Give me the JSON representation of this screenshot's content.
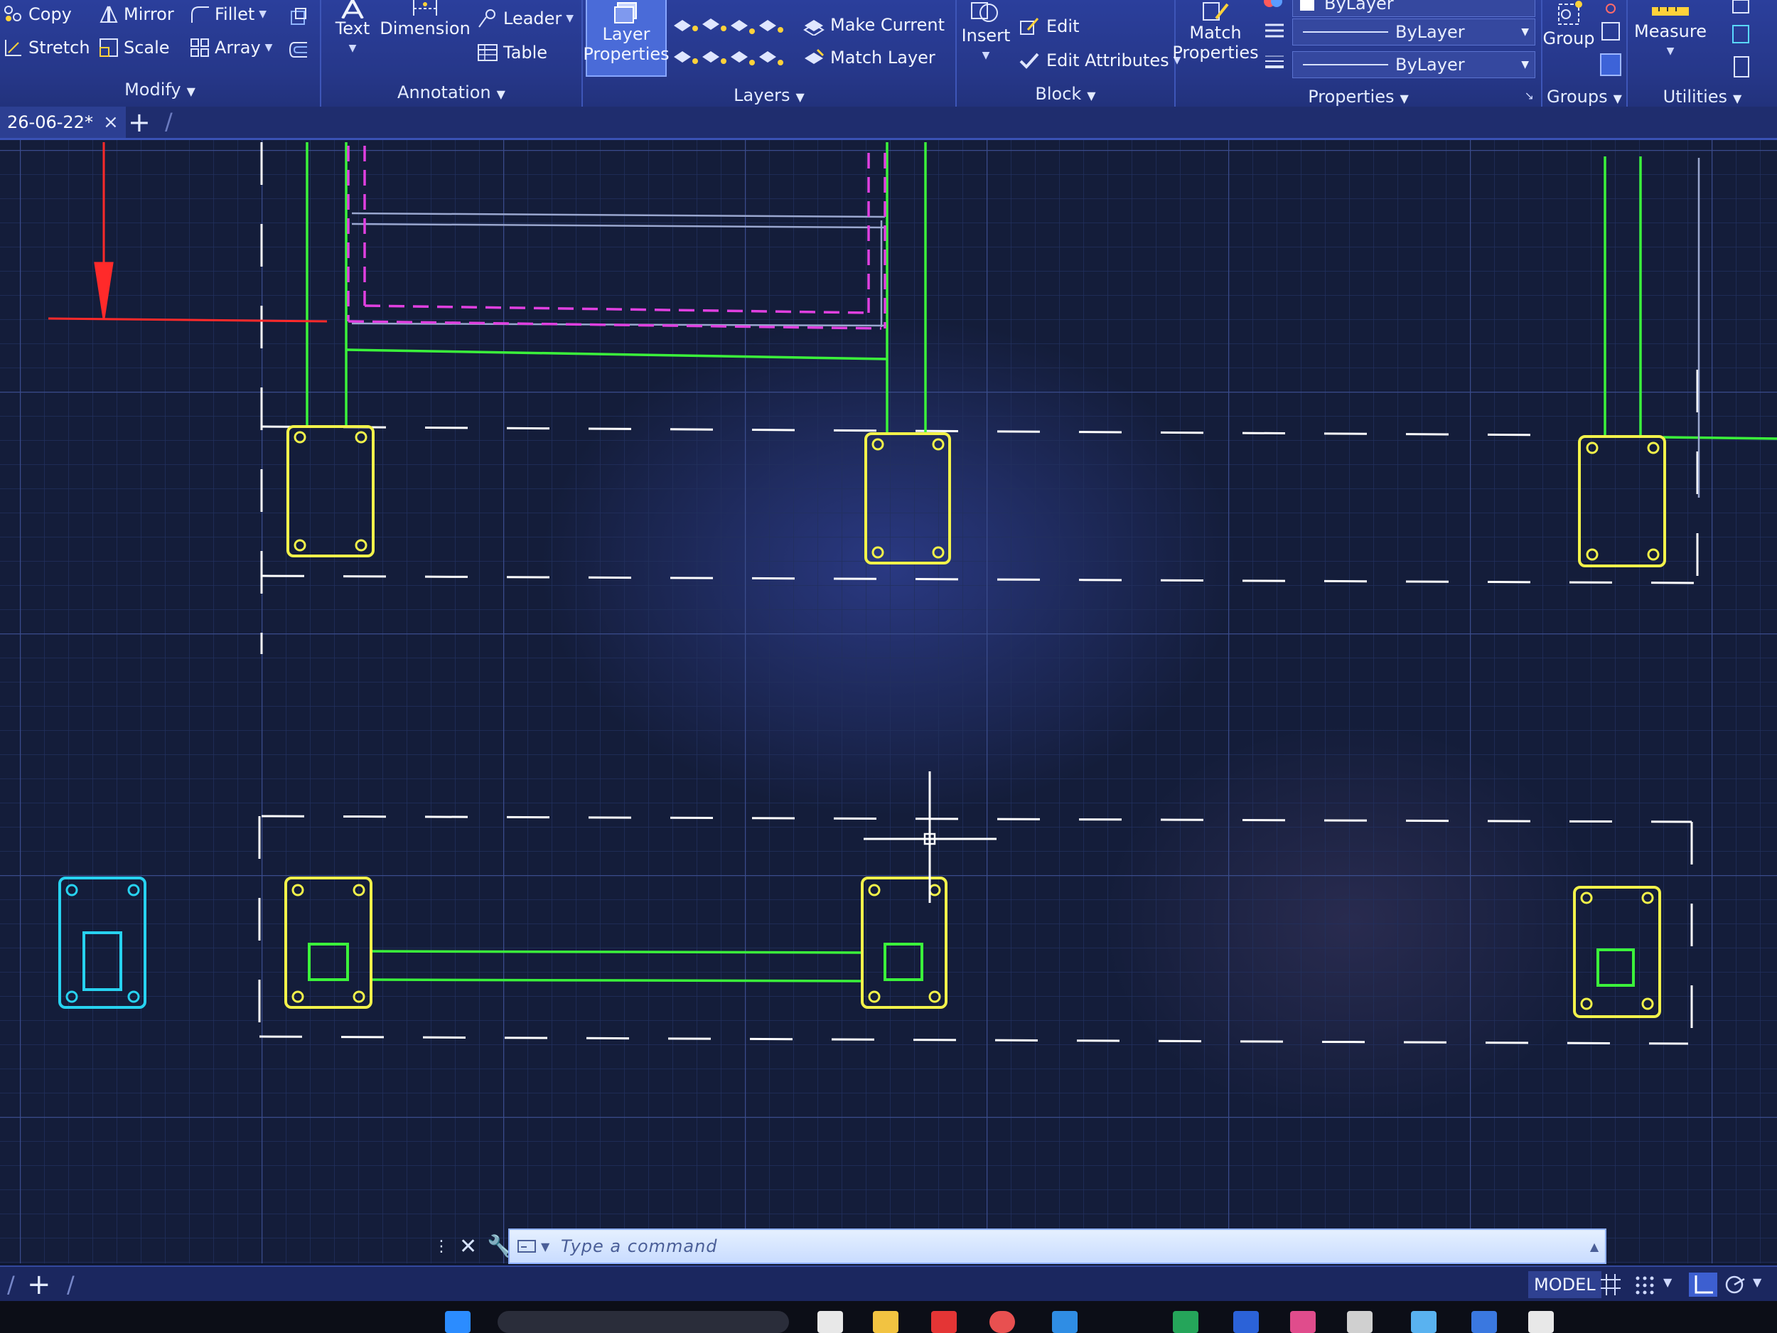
{
  "ribbon": {
    "modify": {
      "title": "Modify",
      "copy": "Copy",
      "mirror": "Mirror",
      "fillet": "Fillet",
      "stretch": "Stretch",
      "scale": "Scale",
      "array": "Array"
    },
    "annotation": {
      "title": "Annotation",
      "text": "Text",
      "dimension": "Dimension",
      "leader": "Leader",
      "table": "Table"
    },
    "layers": {
      "title": "Layers",
      "layer_properties_line1": "Layer",
      "layer_properties_line2": "Properties",
      "make_current": "Make Current",
      "match_layer": "Match Layer"
    },
    "block": {
      "title": "Block",
      "insert": "Insert",
      "edit": "Edit",
      "edit_attributes": "Edit Attributes"
    },
    "properties": {
      "title": "Properties",
      "match_properties_line1": "Match",
      "match_properties_line2": "Properties",
      "bylayer_top": "ByLayer",
      "linetype_value": "ByLayer",
      "lineweight_value": "ByLayer"
    },
    "groups": {
      "title": "Groups",
      "group": "Group"
    },
    "utilities": {
      "title": "Utilities",
      "measure": "Measure"
    }
  },
  "tabs": {
    "active_doc": "26-06-22*",
    "close": "×",
    "add": "+"
  },
  "command": {
    "placeholder": "Type a command"
  },
  "status": {
    "model": "MODEL"
  },
  "colors": {
    "ribbon_bg": "#2b3f9c",
    "canvas_bg": "#141d3a",
    "footing_yellow": "#f2f24a",
    "wall_green": "#3bf23b",
    "hidden_magenta": "#e040e0",
    "dim_red": "#ff2a2a",
    "cyan_block": "#27d2f0",
    "dash_white": "#ffffff"
  }
}
